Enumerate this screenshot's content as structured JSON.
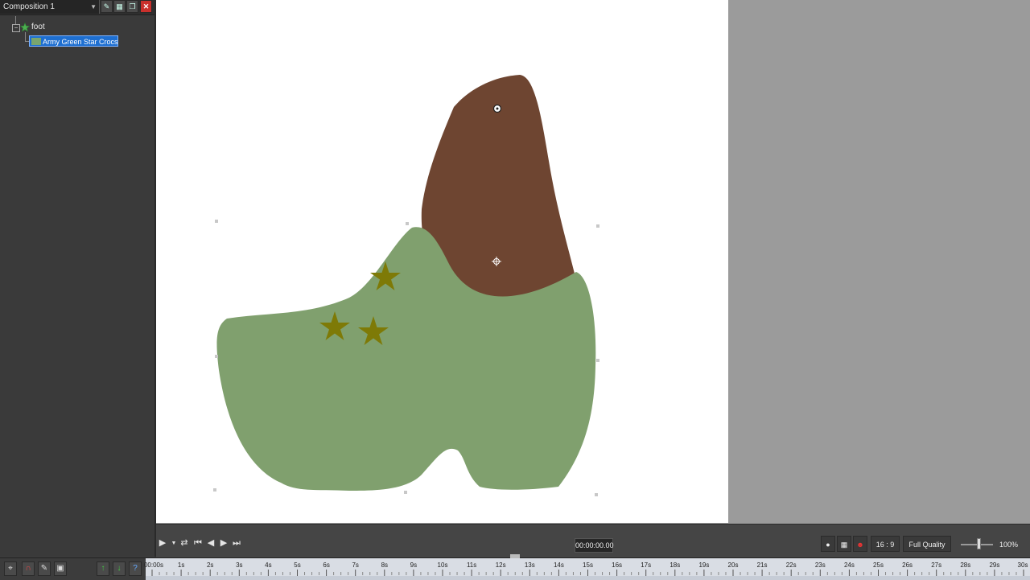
{
  "layers_panel": {
    "composition_name": "Composition 1",
    "group_name": "foot",
    "layer_name": "Army Green Star Crocs Shoes",
    "toolbar_icons": [
      "layer-settings-icon",
      "add-layer-icon",
      "duplicate-layer-icon",
      "delete-layer-icon"
    ]
  },
  "colors": {
    "shoe_body": "#80a06e",
    "shoe_top": "#6e4531",
    "star": "#7e7a07",
    "selection": "#1e6fd1",
    "canvas_bg": "#ffffff",
    "workspace_bg": "#9b9b9b"
  },
  "playback": {
    "timecode": "00:00:00.00",
    "buttons": [
      "play-icon",
      "loop-icon",
      "go-start-icon",
      "step-back-icon",
      "step-forward-icon",
      "go-end-icon"
    ]
  },
  "view_controls": {
    "aspect_ratio": "16 : 9",
    "quality": "Full Quality",
    "zoom": "100%",
    "zoom_level": 0.5
  },
  "timeline": {
    "tick_labels": [
      "00:00s",
      "1s",
      "2s",
      "3s",
      "4s",
      "5s",
      "6s",
      "7s",
      "8s",
      "9s",
      "10s",
      "11s",
      "12s",
      "13s",
      "14s",
      "15s",
      "16s",
      "17s",
      "18s",
      "19s",
      "20s",
      "21s",
      "22s",
      "23s",
      "24s",
      "25s",
      "26s",
      "27s",
      "28s",
      "29s",
      "30s"
    ]
  }
}
